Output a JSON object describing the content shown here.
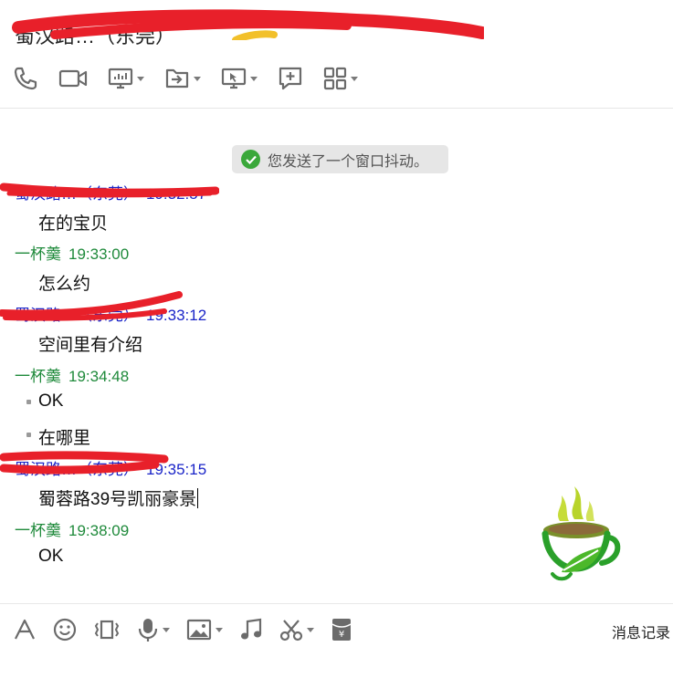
{
  "header": {
    "title": "蜀汉路…（东莞）",
    "toolbar": [
      {
        "icon": "phone-icon",
        "dropdown": false
      },
      {
        "icon": "video-call-icon",
        "dropdown": false
      },
      {
        "icon": "screen-share-icon",
        "dropdown": true
      },
      {
        "icon": "transfer-file-icon",
        "dropdown": true
      },
      {
        "icon": "remote-desktop-icon",
        "dropdown": true
      },
      {
        "icon": "add-discussion-icon",
        "dropdown": false
      },
      {
        "icon": "apps-grid-icon",
        "dropdown": true
      }
    ]
  },
  "chat": {
    "notice": "您发送了一个窗口抖动。",
    "messages": [
      {
        "sender": "蜀汉路…（东莞）",
        "time": "19:32:57",
        "self": false,
        "text": "在的宝贝"
      },
      {
        "sender": "一杯羹",
        "time": "19:33:00",
        "self": true,
        "text": "怎么约"
      },
      {
        "sender": "蜀汉路…（东莞）",
        "time": "19:33:12",
        "self": false,
        "text": "空间里有介绍"
      },
      {
        "sender": "一杯羹",
        "time": "19:34:48",
        "self": true,
        "text": "OK"
      },
      {
        "sender": "",
        "time": "",
        "self": true,
        "text": "在哪里"
      },
      {
        "sender": "蜀汉路…（东莞）",
        "time": "19:35:15",
        "self": false,
        "text": "蜀蓉路39号凯丽豪景"
      },
      {
        "sender": "一杯羹",
        "time": "19:38:09",
        "self": true,
        "text": "OK"
      }
    ]
  },
  "input_toolbar": {
    "tools": [
      {
        "icon": "font-icon",
        "dropdown": false
      },
      {
        "icon": "emoji-icon",
        "dropdown": false
      },
      {
        "icon": "window-shake-icon",
        "dropdown": false
      },
      {
        "icon": "microphone-icon",
        "dropdown": true
      },
      {
        "icon": "image-icon",
        "dropdown": true
      },
      {
        "icon": "music-icon",
        "dropdown": false
      },
      {
        "icon": "scissors-icon",
        "dropdown": true
      },
      {
        "icon": "red-packet-icon",
        "dropdown": false
      }
    ],
    "history_label": "消息记录"
  },
  "colors": {
    "other_sender": "#1a24c8",
    "self_sender": "#1f8a3b",
    "redaction": "#e8202a",
    "notice_bg": "#e6e6e6",
    "check_green": "#3aa83a"
  }
}
